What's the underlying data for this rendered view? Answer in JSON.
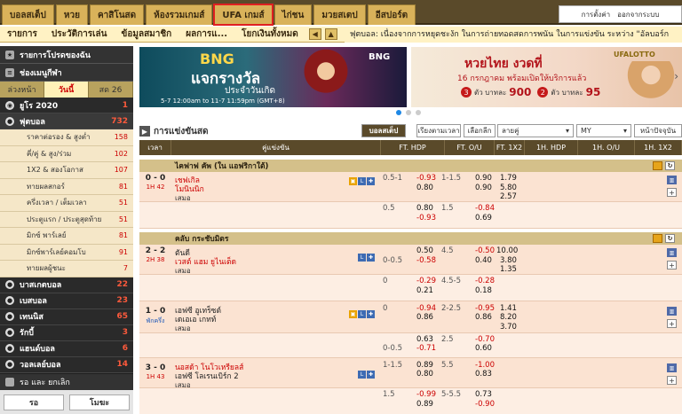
{
  "top_tabs": [
    "บอลสเต็ป",
    "หวย",
    "คาสิโนสด",
    "ห้องรวมเกมส์",
    "UFA เกมส์",
    "ไก่ชน",
    "มวยสเตป",
    "อีสปอร์ต"
  ],
  "user_links": {
    "settings": "การตั้งค่า",
    "logout": "ออกจากระบบ"
  },
  "subnav": [
    "รายการ",
    "ประวัติการเล่น",
    "ข้อมูลสมาชิก",
    "ผลการแ...",
    "โยกเงินทั้งหมด"
  ],
  "ticker": "ฟุตบอล: เนื่องจากการหยุดชะงัก ในการถ่ายทอดสดการพนัน ในการแข่งขัน ระหว่าง \"อัลบอร์ก",
  "sidebar": {
    "fav_label": "รายการโปรดของฉัน",
    "menu_label": "ช่องเมนูกีฬา",
    "tabs": [
      "ล่วงหน้า",
      "วันนี้",
      "สด 26"
    ],
    "sports": [
      {
        "name": "ยูโร 2020",
        "count": "1"
      },
      {
        "name": "ฟุตบอล",
        "count": "732"
      }
    ],
    "football_subs": [
      {
        "name": "ราคาต่อรอง & สูงต่ำ",
        "count": "158"
      },
      {
        "name": "คี่/คู่ & สูง/ร่วม",
        "count": "102"
      },
      {
        "name": "1X2 & สองโอกาส",
        "count": "107"
      },
      {
        "name": "ทายผลสกอร์",
        "count": "81"
      },
      {
        "name": "ครึ่งเวลา / เต็มเวลา",
        "count": "51"
      },
      {
        "name": "ประตูแรก / ประตูสุดท้าย",
        "count": "51"
      },
      {
        "name": "มิกซ์ พาร์เลย์",
        "count": "81"
      },
      {
        "name": "มิกซ์พาร์เลย์คอมโบ",
        "count": "91"
      },
      {
        "name": "ทายผลผู้ชนะ",
        "count": "7"
      }
    ],
    "other_sports": [
      {
        "name": "บาสเกตบอล",
        "count": "22"
      },
      {
        "name": "เบสบอล",
        "count": "23"
      },
      {
        "name": "เทนนิส",
        "count": "65"
      },
      {
        "name": "รักบี้",
        "count": "3"
      },
      {
        "name": "แฮนด์บอล",
        "count": "6"
      },
      {
        "name": "วอลเลย์บอล",
        "count": "14"
      }
    ],
    "footer_title": "รอ และ ยกเลิก",
    "btn_wait": "รอ",
    "btn_void": "โมฆะ"
  },
  "banners": {
    "left_brand": "BNG",
    "left_title": "แจกรางวัล",
    "left_sub": "ประจำวันเกิด",
    "left_dates": "5-7 12:00am to 11-7 11:59pm (GMT+8)",
    "right_title": "หวยไทย งวดที่",
    "right_sub": "16 กรกฎาคม พร้อมเปิดให้บริการแล้ว",
    "right_brand": "UFALOTTO",
    "right_p3": "3",
    "right_p3_text": "ตัว บาทละ",
    "right_p3_val": "900",
    "right_p2": "2",
    "right_p2_text": "ตัว บาทละ",
    "right_p2_val": "95"
  },
  "toolbar": {
    "title": "การแข่งขันสด",
    "single_bet": "บอลสเต็ป",
    "sort_time": "เรียงตามเวลา",
    "choose_league": "เลือกลีก",
    "odds_type": "ลายคู่",
    "currency": "MY",
    "page": "หน้าปัจจุบัน"
  },
  "headers": [
    "เวลา",
    "คู่แข่งขัน",
    "FT. HDP",
    "FT. O/U",
    "FT. 1X2",
    "1H. HDP",
    "1H. O/U",
    "1H. 1X2"
  ],
  "leagues": [
    {
      "name": "ไคฟาฟ คัพ (ใน แอฟริกาใต้)",
      "matches": [
        {
          "score": "0 - 0",
          "time": "1H 42",
          "home": "เชฟเกิล",
          "away": "โมนินนิก",
          "draw": "เสมอ",
          "lines": [
            {
              "hdp": "0.5-1",
              "h1": "-0.93",
              "h2": "0.80",
              "ou": "1-1.5",
              "o1": "0.90",
              "o2": "0.90",
              "x1": "1.79",
              "x2": "5.80",
              "x3": "2.57"
            },
            {
              "hdp": "0.5",
              "h1": "0.80",
              "h2": "-0.93",
              "ou": "1.5",
              "o1": "-0.84",
              "o2": "0.69"
            }
          ]
        }
      ]
    },
    {
      "name": "คลับ กระชับมิตร",
      "matches": [
        {
          "score": "2 - 2",
          "time": "2H 38",
          "home": "ตันดี",
          "away": "เวสต์ แฮม ยูไนเต็ด",
          "draw": "เสมอ",
          "lines": [
            {
              "hdp": "0-0.5",
              "h1": "0.50",
              "h2": "-0.58",
              "ou": "4.5",
              "o1": "-0.50",
              "o2": "0.40",
              "x1": "10.00",
              "x2": "3.80",
              "x3": "1.35"
            },
            {
              "hdp": "0",
              "h1": "-0.29",
              "h2": "0.21",
              "ou": "4.5-5",
              "o1": "-0.28",
              "o2": "0.18"
            }
          ]
        },
        {
          "score": "1 - 0",
          "time": "พักครึ่ง",
          "home": "เอฟซี อูเทร็ซต์",
          "away": "เดเอเอ เกทท์",
          "draw": "เสมอ",
          "lines": [
            {
              "hdp": "0",
              "h1": "-0.94",
              "h2": "0.86",
              "ou": "2-2.5",
              "o1": "-0.95",
              "o2": "0.86",
              "x1": "1.41",
              "x2": "8.20",
              "x3": "3.70"
            },
            {
              "hdp": "0-0.5",
              "h1": "0.63",
              "h2": "-0.71",
              "ou": "2.5",
              "o1": "-0.70",
              "o2": "0.60"
            }
          ]
        },
        {
          "score": "3 - 0",
          "time": "1H 43",
          "home": "นอสด้า โนโวเหรียลส์",
          "away": "เอฟซี โลเรนเบิร์ก 2",
          "draw": "เสมอ",
          "lines": [
            {
              "hdp": "1-1.5",
              "h1": "0.89",
              "h2": "0.80",
              "ou": "5.5",
              "o1": "-1.00",
              "o2": "0.83"
            },
            {
              "hdp": "1.5",
              "h1": "-0.99",
              "h2": "0.89",
              "ou": "5-5.5",
              "o1": "0.73",
              "o2": "-0.90"
            }
          ]
        }
      ]
    }
  ]
}
